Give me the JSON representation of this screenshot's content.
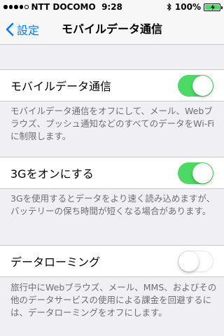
{
  "status_bar": {
    "carrier": "NTT DOCOMO",
    "time": "9:28",
    "battery_percent": "100%",
    "signal_bars_filled": 4,
    "signal_bars_total": 5
  },
  "nav": {
    "back_label": "設定",
    "title": "モバイルデータ通信"
  },
  "settings": [
    {
      "label": "モバイルデータ通信",
      "enabled": true,
      "footer": "モバイルデータ通信をオフにして、メール、Webブラウズ、プッシュ通知などのすべてのデータをWi-Fiに制限します。"
    },
    {
      "label": "3Gをオンにする",
      "enabled": true,
      "footer": "3Gを使用するとデータをより速く読み込めますが、バッテリーの保ち時間が短くなる場合があります。"
    },
    {
      "label": "データローミング",
      "enabled": false,
      "footer": "旅行中にWebブラウズ、メール、MMS、およびその他のデータサービスの使用による課金を回避するには、データローミングをオフにします。"
    }
  ],
  "colors": {
    "accent": "#007aff",
    "switch_on": "#4cd964",
    "background": "#efeff4",
    "footer_text": "#6d6d72"
  }
}
